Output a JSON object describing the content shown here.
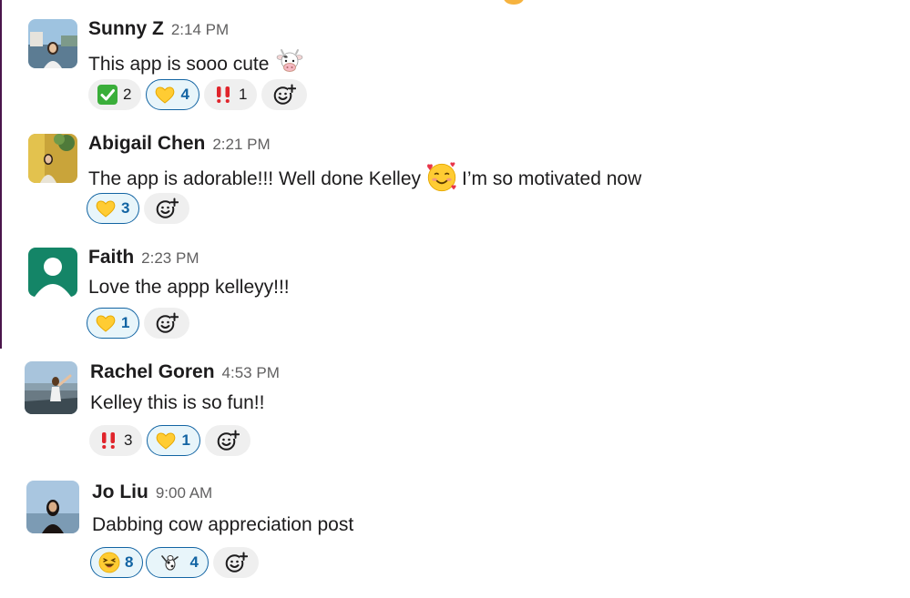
{
  "messages": [
    {
      "author": "Sunny Z",
      "time": "2:14 PM",
      "text": "This app is sooo cute",
      "text_emoji": "cow-face",
      "reactions": [
        {
          "emoji": "white-check-mark",
          "count": "2",
          "mine": false
        },
        {
          "emoji": "yellow-heart",
          "count": "4",
          "mine": true
        },
        {
          "emoji": "double-exclamation",
          "count": "1",
          "mine": false
        }
      ]
    },
    {
      "author": "Abigail Chen",
      "time": "2:21 PM",
      "text_before": "The app is adorable!!! Well done Kelley",
      "text_emoji": "smiling-face-with-hearts",
      "text_after": "I’m so motivated now",
      "reactions": [
        {
          "emoji": "yellow-heart",
          "count": "3",
          "mine": true
        }
      ]
    },
    {
      "author": "Faith",
      "time": "2:23 PM",
      "text": "Love the appp kelleyy!!!",
      "reactions": [
        {
          "emoji": "yellow-heart",
          "count": "1",
          "mine": true
        }
      ]
    },
    {
      "author": "Rachel Goren",
      "time": "4:53 PM",
      "text": "Kelley this is so fun!!",
      "reactions": [
        {
          "emoji": "double-exclamation",
          "count": "3",
          "mine": false
        },
        {
          "emoji": "yellow-heart",
          "count": "1",
          "mine": true
        }
      ]
    },
    {
      "author": "Jo Liu",
      "time": "9:00 AM",
      "text": "Dabbing cow appreciation post",
      "reactions": [
        {
          "emoji": "laughing-face",
          "count": "8",
          "mine": true
        },
        {
          "emoji": "dabbing-cow",
          "count": "4",
          "mine": true
        }
      ]
    }
  ],
  "icons": {
    "add_reaction": "add-reaction-icon"
  },
  "colors": {
    "mine_border": "#1264a3",
    "mine_bg": "#e8f5fa",
    "pill_bg": "#efefef",
    "timestamp": "#616061",
    "sidebar_edge": "#4a154b"
  }
}
